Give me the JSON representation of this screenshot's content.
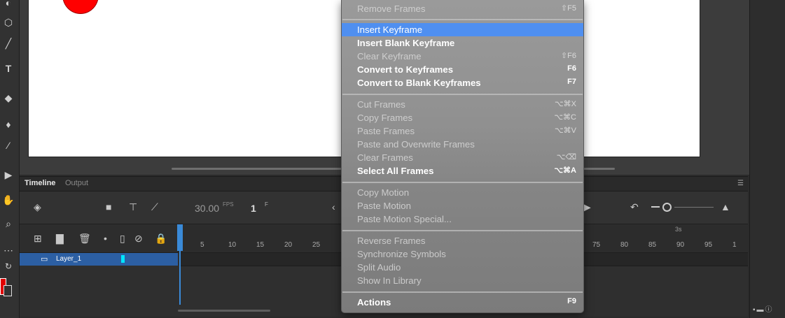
{
  "timeline": {
    "tabs": [
      "Timeline",
      "Output"
    ],
    "fps_value": "30.00",
    "fps_label": "FPS",
    "current_frame": "1",
    "frame_label": "F",
    "layer_name": "Layer_1",
    "ticks": [
      "5",
      "10",
      "15",
      "20",
      "25",
      "75",
      "80",
      "85",
      "90",
      "95",
      "1"
    ],
    "seconds_marker": "3s"
  },
  "context_menu": {
    "items": [
      {
        "label": "Remove Frames",
        "shortcut": "⇧F5",
        "enabled": false
      },
      {
        "label": "Insert Keyframe",
        "shortcut": "",
        "enabled": true,
        "highlighted": true
      },
      {
        "label": "Insert Blank Keyframe",
        "shortcut": "",
        "enabled": true
      },
      {
        "label": "Clear Keyframe",
        "shortcut": "⇧F6",
        "enabled": false
      },
      {
        "label": "Convert to Keyframes",
        "shortcut": "F6",
        "enabled": true
      },
      {
        "label": "Convert to Blank Keyframes",
        "shortcut": "F7",
        "enabled": true
      },
      {
        "label": "Cut Frames",
        "shortcut": "⌥⌘X",
        "enabled": false
      },
      {
        "label": "Copy Frames",
        "shortcut": "⌥⌘C",
        "enabled": false
      },
      {
        "label": "Paste Frames",
        "shortcut": "⌥⌘V",
        "enabled": false
      },
      {
        "label": "Paste and Overwrite Frames",
        "shortcut": "",
        "enabled": false
      },
      {
        "label": "Clear Frames",
        "shortcut": "⌥⌫",
        "enabled": false
      },
      {
        "label": "Select All Frames",
        "shortcut": "⌥⌘A",
        "enabled": true
      },
      {
        "label": "Copy Motion",
        "shortcut": "",
        "enabled": false
      },
      {
        "label": "Paste Motion",
        "shortcut": "",
        "enabled": false
      },
      {
        "label": "Paste Motion Special...",
        "shortcut": "",
        "enabled": false
      },
      {
        "label": "Reverse Frames",
        "shortcut": "",
        "enabled": false
      },
      {
        "label": "Synchronize Symbols",
        "shortcut": "",
        "enabled": false
      },
      {
        "label": "Split Audio",
        "shortcut": "",
        "enabled": false
      },
      {
        "label": "Show In Library",
        "shortcut": "",
        "enabled": false
      },
      {
        "label": "Actions",
        "shortcut": "F9",
        "enabled": true
      }
    ]
  },
  "colors": {
    "stroke_swatch": "#e00000",
    "layer_highlight": "#2c5fa3",
    "menu_highlight": "#4f8ff0",
    "layer_outline_color": "#00e5ff",
    "shape_fill": "#ff0000"
  },
  "icons": {
    "left_tools": [
      "selection-icon",
      "polystar-icon",
      "line-icon",
      "text-icon",
      "eraser-icon",
      "paint-bucket-icon",
      "eyedropper-icon",
      "camera-icon",
      "hand-icon",
      "zoom-icon",
      "more-icon",
      "swap-colors-icon"
    ],
    "timeline_toolbar": [
      "layers-icon",
      "camera-icon",
      "parenting-icon",
      "graph-icon",
      "loop-icon",
      "onion-skin-icon"
    ],
    "layer_controls": [
      "add-layer-icon",
      "add-folder-icon",
      "delete-icon",
      "dot-icon",
      "outline-icon",
      "eye-icon",
      "lock-icon"
    ]
  }
}
